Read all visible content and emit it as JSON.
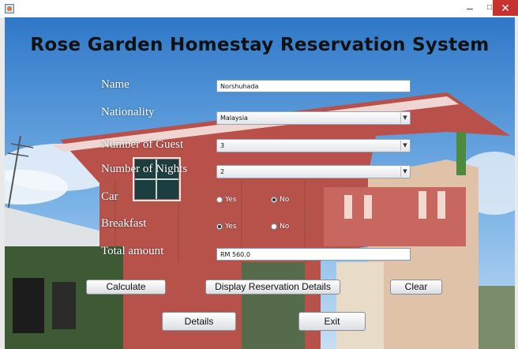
{
  "window": {
    "title": "",
    "controls": {
      "minimize": "–",
      "maximize": "□",
      "close": "✕"
    }
  },
  "heading": "Rose Garden Homestay Reservation System",
  "form": {
    "name": {
      "label": "Name",
      "value": "Norshuhada"
    },
    "nationality": {
      "label": "Nationality",
      "value": "Malaysia"
    },
    "guests": {
      "label": "Number of Guest",
      "value": "3"
    },
    "nights": {
      "label": "Number of Nights",
      "value": "2"
    },
    "car": {
      "label": "Car",
      "yes": "Yes",
      "no": "No",
      "selected": "No"
    },
    "breakfast": {
      "label": "Breakfast",
      "yes": "Yes",
      "no": "No",
      "selected": "Yes"
    },
    "total": {
      "label": "Total amount",
      "value": "RM 560.0"
    }
  },
  "buttons": {
    "calculate": "Calculate",
    "display": "Display Reservation Details",
    "clear": "Clear",
    "details": "Details",
    "exit": "Exit"
  },
  "colors": {
    "close_button": "#c7312e",
    "label_text": "#ffffff",
    "heading_text": "#111111"
  },
  "icons": {
    "app": "java-app-icon",
    "dropdown": "chevron-down-icon"
  }
}
